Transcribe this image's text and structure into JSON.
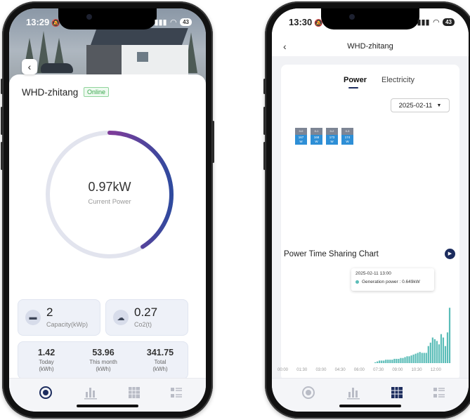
{
  "left_screen": {
    "status_time": "13:29",
    "battery": "43",
    "device_name": "WHD-zhitang",
    "status_badge": "Online",
    "gauge": {
      "value": "0.97kW",
      "label": "Current Power",
      "fill_fraction": 0.41,
      "gradient": [
        "#a8288a",
        "#7a3d9a",
        "#2f4a9e"
      ],
      "track_color": "#e2e4ee"
    },
    "capacity": {
      "value": "2",
      "label": "Capacity(kWp)"
    },
    "co2": {
      "value": "0.27",
      "label": "Co2(t)"
    },
    "energy": [
      {
        "value": "1.42",
        "label": "Today",
        "unit": "(kWh)"
      },
      {
        "value": "53.96",
        "label": "This month",
        "unit": "(kWh)"
      },
      {
        "value": "341.75",
        "label": "Total",
        "unit": "(kWh)"
      }
    ]
  },
  "right_screen": {
    "status_time": "13:30",
    "battery": "43",
    "title": "WHD-zhitang",
    "tabs": [
      {
        "label": "Power",
        "active": true
      },
      {
        "label": "Electricity",
        "active": false
      }
    ],
    "date": "2025-02-11",
    "panels": [
      {
        "id": "0-0",
        "value": "167",
        "unit": "W"
      },
      {
        "id": "0-1",
        "value": "168",
        "unit": "W"
      },
      {
        "id": "0-2",
        "value": "173",
        "unit": "W"
      },
      {
        "id": "0-3",
        "value": "174",
        "unit": "W"
      }
    ],
    "chart_title": "Power Time Sharing Chart",
    "tooltip": {
      "time": "2025-02-11 13:00",
      "series_text": "Generation power : 0.649kW"
    }
  },
  "tabbar": {
    "items": [
      {
        "name": "dashboard-icon"
      },
      {
        "name": "bar-chart-icon"
      },
      {
        "name": "panel-grid-icon"
      },
      {
        "name": "list-icon"
      }
    ],
    "active_color": "#1c2c5e",
    "inactive_color": "#b9bcc6"
  },
  "chart_data": {
    "type": "bar",
    "title": "Power Time Sharing Chart",
    "x_tick_labels": [
      "00:00",
      "01:30",
      "03:00",
      "04:30",
      "06:00",
      "07:30",
      "09:00",
      "10:30",
      "12:00"
    ],
    "x": [
      "07:10",
      "07:20",
      "07:30",
      "07:40",
      "07:50",
      "08:00",
      "08:10",
      "08:20",
      "08:30",
      "08:40",
      "08:50",
      "09:00",
      "09:10",
      "09:20",
      "09:30",
      "09:40",
      "09:50",
      "10:00",
      "10:10",
      "10:20",
      "10:30",
      "10:40",
      "10:50",
      "11:00",
      "11:10",
      "11:20",
      "11:30",
      "11:40",
      "11:50",
      "12:00",
      "12:10",
      "12:20",
      "12:30",
      "12:40",
      "12:50",
      "13:00"
    ],
    "series": [
      {
        "color": "#5bbdb8",
        "values": [
          0.01,
          0.02,
          0.03,
          0.03,
          0.03,
          0.04,
          0.04,
          0.04,
          0.04,
          0.05,
          0.05,
          0.05,
          0.06,
          0.06,
          0.07,
          0.08,
          0.08,
          0.09,
          0.1,
          0.11,
          0.12,
          0.13,
          0.12,
          0.12,
          0.12,
          0.2,
          0.24,
          0.3,
          0.28,
          0.26,
          0.22,
          0.34,
          0.3,
          0.2,
          0.36,
          0.649
        ]
      }
    ],
    "xlim": [
      "00:00",
      "13:30"
    ],
    "ylim": [
      0,
      0.7
    ],
    "grid": false
  }
}
